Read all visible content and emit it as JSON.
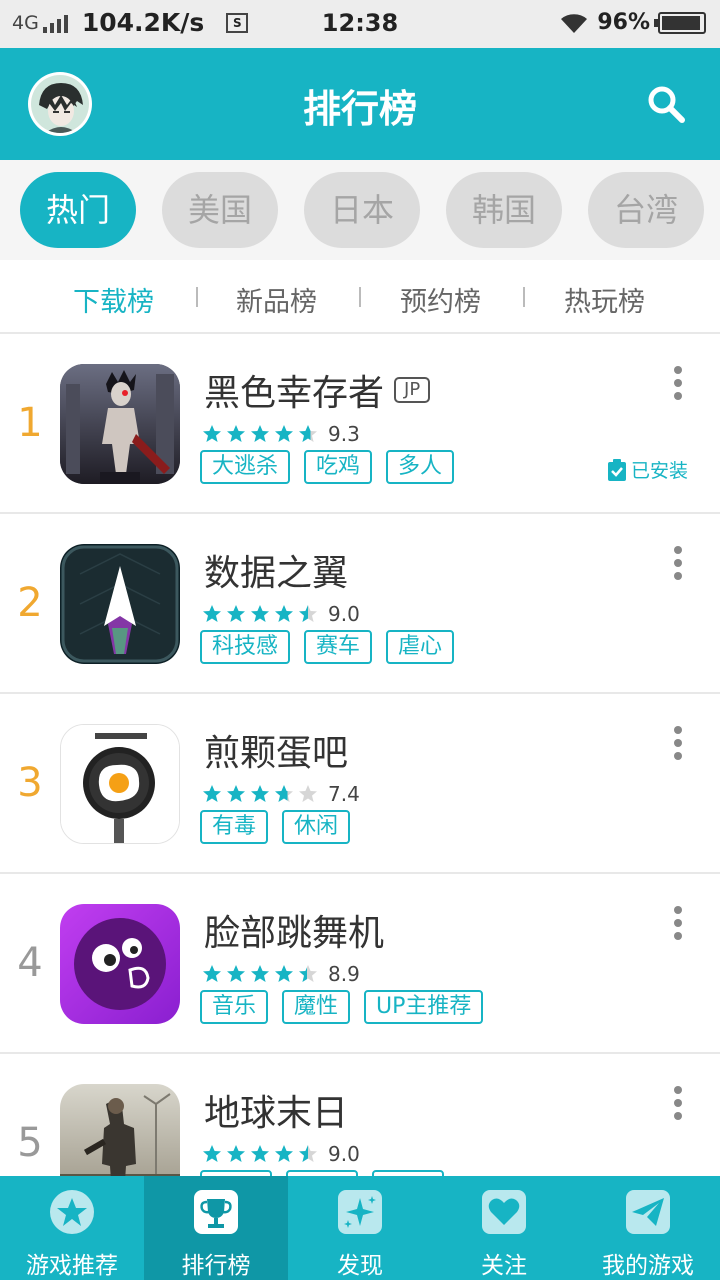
{
  "status_bar": {
    "network": "4G",
    "speed": "104.2K/s",
    "sim_icon": "S",
    "time": "12:38",
    "battery": "96%",
    "battery_level": 0.96
  },
  "header": {
    "title": "排行榜",
    "avatar_icon": "user-avatar",
    "search_icon": "search-icon"
  },
  "regions": [
    {
      "label": "热门",
      "active": true
    },
    {
      "label": "美国",
      "active": false
    },
    {
      "label": "日本",
      "active": false
    },
    {
      "label": "韩国",
      "active": false
    },
    {
      "label": "台湾",
      "active": false
    }
  ],
  "subtabs": [
    {
      "label": "下载榜",
      "active": true
    },
    {
      "label": "新品榜",
      "active": false
    },
    {
      "label": "预约榜",
      "active": false
    },
    {
      "label": "热玩榜",
      "active": false
    }
  ],
  "games": [
    {
      "rank": "1",
      "name": "黑色幸存者",
      "badge": "JP",
      "rating": 9.3,
      "score": "9.3",
      "tags": [
        "大逃杀",
        "吃鸡",
        "多人"
      ],
      "installed": "已安装",
      "rank_color": "#f0a830"
    },
    {
      "rank": "2",
      "name": "数据之翼",
      "badge": "",
      "rating": 9.0,
      "score": "9.0",
      "tags": [
        "科技感",
        "赛车",
        "虐心"
      ],
      "installed": "",
      "rank_color": "#f0a830"
    },
    {
      "rank": "3",
      "name": "煎颗蛋吧",
      "badge": "",
      "rating": 7.4,
      "score": "7.4",
      "tags": [
        "有毒",
        "休闲"
      ],
      "installed": "",
      "rank_color": "#f0a830"
    },
    {
      "rank": "4",
      "name": "脸部跳舞机",
      "badge": "",
      "rating": 8.9,
      "score": "8.9",
      "tags": [
        "音乐",
        "魔性",
        "UP主推荐"
      ],
      "installed": "",
      "rank_color": "#999999"
    },
    {
      "rank": "5",
      "name": "地球末日",
      "badge": "",
      "rating": 9.0,
      "score": "9.0",
      "tags": [
        "",
        "",
        ""
      ],
      "installed": "",
      "rank_color": "#999999"
    }
  ],
  "bottom_nav": [
    {
      "label": "游戏推荐",
      "icon": "star-icon",
      "active": false
    },
    {
      "label": "排行榜",
      "icon": "trophy-icon",
      "active": true
    },
    {
      "label": "发现",
      "icon": "sparkle-icon",
      "active": false
    },
    {
      "label": "关注",
      "icon": "heart-icon",
      "active": false
    },
    {
      "label": "我的游戏",
      "icon": "paper-plane-icon",
      "active": false
    }
  ],
  "colors": {
    "accent": "#17b4c4",
    "accent_dark": "#0f97a6",
    "rank_top": "#f0a830",
    "rank_other": "#999999"
  }
}
